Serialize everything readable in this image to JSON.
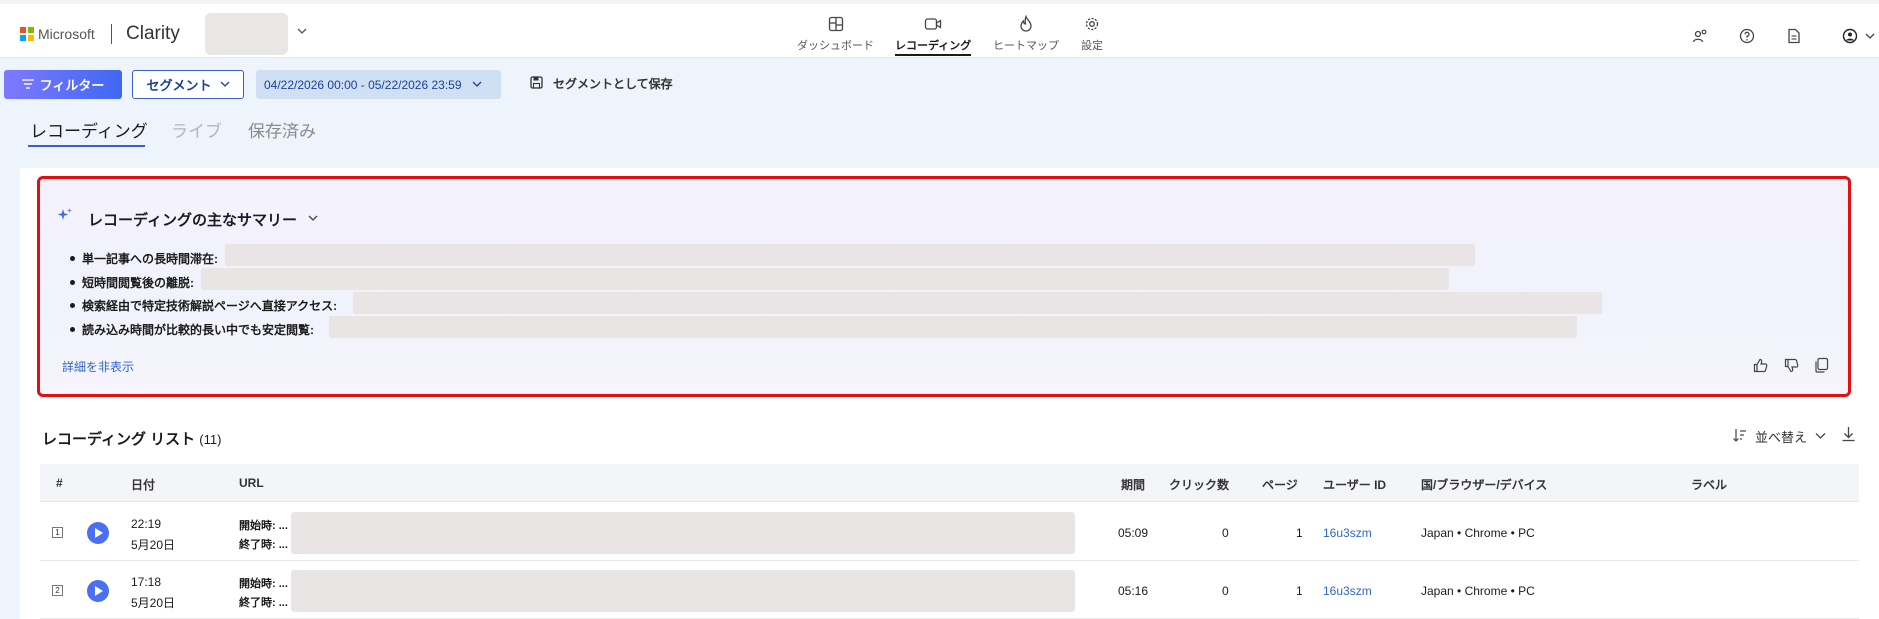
{
  "header": {
    "brand": "Microsoft",
    "app_name": "Clarity",
    "nav": [
      {
        "label": "ダッシュボード",
        "icon": "dashboard-icon"
      },
      {
        "label": "レコーディング",
        "icon": "video-icon",
        "active": true
      },
      {
        "label": "ヒートマップ",
        "icon": "flame-icon"
      },
      {
        "label": "設定",
        "icon": "gear-icon"
      }
    ]
  },
  "toolbar": {
    "filter_label": "フィルター",
    "segment_label": "セグメント",
    "date_range": "04/22/2026 00:00 - 05/22/2026 23:59",
    "save_segment_label": "セグメントとして保存"
  },
  "tabs": [
    {
      "label": "レコーディング",
      "state": "active"
    },
    {
      "label": "ライブ",
      "state": "disabled"
    },
    {
      "label": "保存済み",
      "state": "normal"
    }
  ],
  "summary": {
    "title": "レコーディングの主なサマリー",
    "items": [
      "単一記事への長時間滞在:",
      "短時間閲覧後の離脱:",
      "検索経由で特定技術解説ページへ直接アクセス:",
      "読み込み時間が比較的長い中でも安定閲覧:"
    ],
    "hide_details": "詳細を非表示"
  },
  "recording_list": {
    "title": "レコーディング リスト",
    "count": "(11)",
    "sort_label": "並べ替え",
    "columns": [
      "#",
      "日付",
      "URL",
      "期間",
      "クリック数",
      "ページ",
      "ユーザー ID",
      "国/ブラウザー/デバイス",
      "ラベル"
    ],
    "rows": [
      {
        "index": "1",
        "time": "22:19",
        "date": "5月20日",
        "start": "開始時: ...",
        "end": "終了時: ...",
        "duration": "05:09",
        "clicks": "0",
        "pages": "1",
        "user_id": "16u3szm",
        "env": "Japan • Chrome • PC",
        "label": ""
      },
      {
        "index": "2",
        "time": "17:18",
        "date": "5月20日",
        "start": "開始時: ...",
        "end": "終了時: ...",
        "duration": "05:16",
        "clicks": "0",
        "pages": "1",
        "user_id": "16u3szm",
        "env": "Japan • Chrome • PC",
        "label": ""
      }
    ]
  }
}
